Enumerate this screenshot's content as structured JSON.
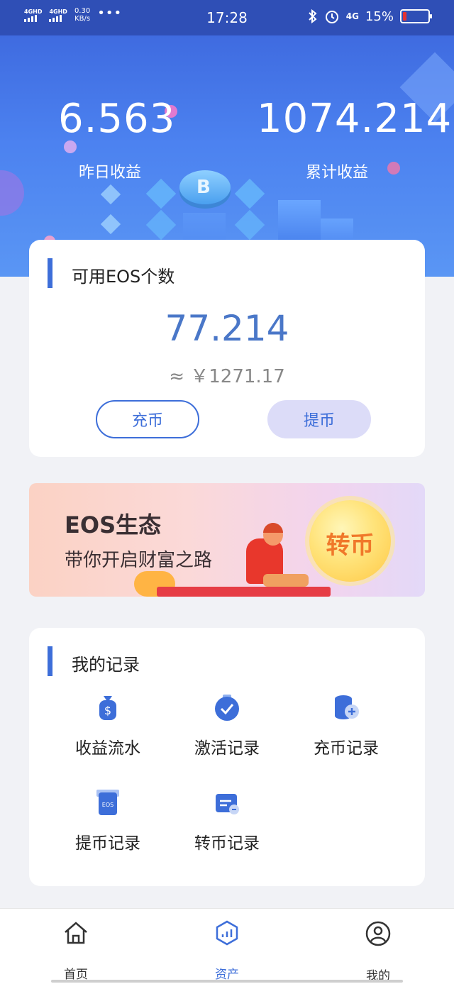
{
  "status_bar": {
    "signal_1": "4GHD",
    "signal_2": "4GHD",
    "speed_value": "0.30",
    "speed_unit": "KB/s",
    "time": "17:28",
    "network": "4G",
    "battery": "15%",
    "battery_level": 0.15,
    "battery_color": "#e53232"
  },
  "header": {
    "yesterday_value": "6.563",
    "yesterday_label": "昨日收益",
    "total_value": "1074.214",
    "total_label": "累计收益",
    "coin_glyph": "B"
  },
  "balance_card": {
    "title": "可用EOS个数",
    "amount": "77.214",
    "cny": "≈ ￥1271.17",
    "deposit_label": "充币",
    "withdraw_label": "提币"
  },
  "promo": {
    "title": "EOS生态",
    "subtitle": "带你开启财富之路",
    "badge": "转币"
  },
  "records": {
    "title": "我的记录",
    "items": [
      {
        "label": "收益流水",
        "icon": "money-bag-icon"
      },
      {
        "label": "激活记录",
        "icon": "check-badge-icon"
      },
      {
        "label": "充币记录",
        "icon": "coin-stack-icon"
      },
      {
        "label": "提币记录",
        "icon": "eos-card-icon"
      },
      {
        "label": "转币记录",
        "icon": "transfer-card-icon"
      }
    ],
    "eos_text": "EOS"
  },
  "tabbar": {
    "tabs": [
      {
        "label": "首页",
        "icon": "home-icon"
      },
      {
        "label": "资产",
        "icon": "assets-icon",
        "active": true
      },
      {
        "label": "我的",
        "icon": "profile-icon"
      }
    ]
  },
  "colors": {
    "accent": "#3d6ed9",
    "banner": "#4c82f0"
  }
}
